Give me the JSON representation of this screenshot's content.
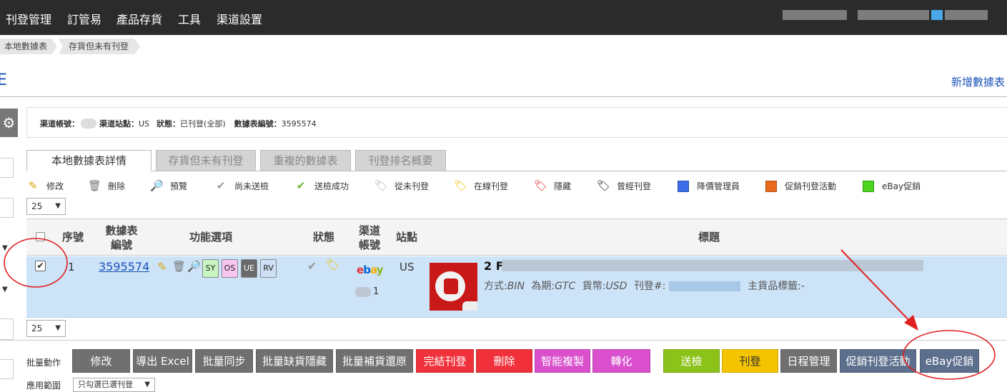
{
  "topnav": {
    "items": [
      "刊登管理",
      "訂管易",
      "產品存貨",
      "工具",
      "渠道設置"
    ]
  },
  "breadcrumb": [
    "本地數據表",
    "存貨但未有刊登"
  ],
  "page": {
    "title_fragment": "E",
    "add_link": "新增數據表"
  },
  "info": {
    "channel_account_label": "渠道帳號：",
    "channel_site_label": "渠道站點：",
    "channel_site_value": "US",
    "status_label": "狀態：",
    "status_value": "已刊登(全部)",
    "datasheet_no_label": "數據表編號：",
    "datasheet_no_value": "3595574"
  },
  "tabs": [
    {
      "label": "本地數據表詳情",
      "active": true
    },
    {
      "label": "存貨但未有刊登",
      "active": false
    },
    {
      "label": "重複的數據表",
      "active": false
    },
    {
      "label": "刊登排名概要",
      "active": false
    }
  ],
  "legend": [
    {
      "label": "修改",
      "icon": "pencil-icon"
    },
    {
      "label": "刪除",
      "icon": "trash-icon"
    },
    {
      "label": "預覽",
      "icon": "magnifier-icon"
    },
    {
      "label": "尚未送檢",
      "icon": "grey-check-icon"
    },
    {
      "label": "送檢成功",
      "icon": "green-check-icon"
    },
    {
      "label": "從未刊登",
      "icon": "grey-tag-icon"
    },
    {
      "label": "在線刊登",
      "icon": "yellow-tag-icon"
    },
    {
      "label": "隱藏",
      "icon": "red-tag-icon"
    },
    {
      "label": "曾經刊登",
      "icon": "black-tag-icon"
    },
    {
      "label": "降價管理員",
      "icon": "blue-square-icon"
    },
    {
      "label": "促銷刊登活動",
      "icon": "orange-square-icon"
    },
    {
      "label": "eBay促銷",
      "icon": "green-square-icon"
    }
  ],
  "page_size": "25",
  "table": {
    "headers": {
      "seq": "序號",
      "datasheet_no_1": "數據表",
      "datasheet_no_2": "編號",
      "functions": "功能選項",
      "status": "狀態",
      "channel_account_1": "渠道",
      "channel_account_2": "帳號",
      "site": "站點",
      "title": "標題"
    },
    "row": {
      "seq": "1",
      "datasheet_no": "3595574",
      "tags": [
        "SY",
        "OS",
        "UE",
        "RV"
      ],
      "channel_logo": "ebay",
      "channel_account_suffix": "1",
      "site": "US",
      "title_prefix": "2 F",
      "detail_method_label": "方式:",
      "detail_method_value": "BIN",
      "detail_period_label": "為期:",
      "detail_period_value": "GTC",
      "detail_currency_label": "貨幣:",
      "detail_currency_value": "USD",
      "detail_listing_label": "刊登#:",
      "detail_main_label": "主貨品標籤:",
      "detail_main_value": "-"
    }
  },
  "batch": {
    "label": "批量動作",
    "buttons": [
      {
        "label": "修改",
        "color": "#707070"
      },
      {
        "label": "導出 Excel",
        "color": "#707070"
      },
      {
        "label": "批量同步",
        "color": "#707070"
      },
      {
        "label": "批量缺貨隱藏",
        "color": "#707070"
      },
      {
        "label": "批量補貨還原",
        "color": "#707070"
      },
      {
        "label": "完結刊登",
        "color": "#f0303a"
      },
      {
        "label": "刪除",
        "color": "#f0303a"
      },
      {
        "label": "智能複製",
        "color": "#d94fcc"
      },
      {
        "label": "轉化",
        "color": "#d94fcc"
      },
      {
        "label": "送檢",
        "color": "#8cc21a"
      },
      {
        "label": "刊登",
        "color": "#f5c400"
      },
      {
        "label": "日程管理",
        "color": "#707070"
      },
      {
        "label": "促銷刊登活動",
        "color": "#5c6f8c"
      },
      {
        "label": "eBay促銷",
        "color": "#5c6f8c"
      }
    ],
    "scope_label": "應用範圍",
    "scope_value": "只勾選已選刊登"
  },
  "colors": {
    "nav_bg": "#2b2b2b",
    "row_selected": "#cde3f8",
    "link": "#1a53b8",
    "annotation": "#e02020"
  }
}
